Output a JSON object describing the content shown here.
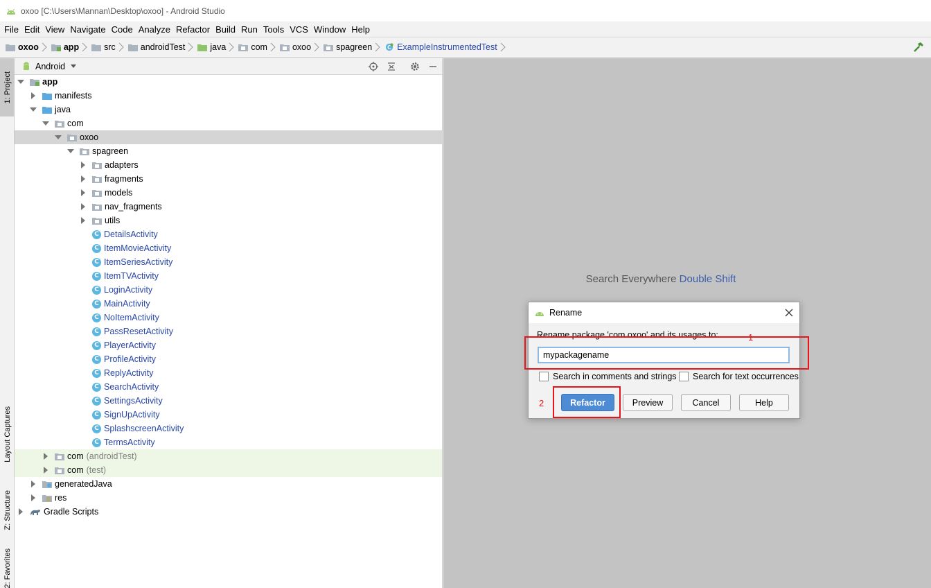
{
  "window": {
    "title": "oxoo [C:\\Users\\Mannan\\Desktop\\oxoo] - Android Studio"
  },
  "menu": [
    "File",
    "Edit",
    "View",
    "Navigate",
    "Code",
    "Analyze",
    "Refactor",
    "Build",
    "Run",
    "Tools",
    "VCS",
    "Window",
    "Help"
  ],
  "breadcrumb": [
    "oxoo",
    "app",
    "src",
    "androidTest",
    "java",
    "com",
    "oxoo",
    "spagreen",
    "ExampleInstrumentedTest"
  ],
  "tool_stripe": {
    "project": "1: Project",
    "layout_captures": "Layout Captures",
    "structure": "Z: Structure",
    "favorites": "2: Favorites"
  },
  "project_panel": {
    "view_mode": "Android",
    "tree": {
      "app": "app",
      "manifests": "manifests",
      "java": "java",
      "com": "com",
      "oxoo": "oxoo",
      "spagreen": "spagreen",
      "folders": [
        "adapters",
        "fragments",
        "models",
        "nav_fragments",
        "utils"
      ],
      "classes": [
        "DetailsActivity",
        "ItemMovieActivity",
        "ItemSeriesActivity",
        "ItemTVActivity",
        "LoginActivity",
        "MainActivity",
        "NoItemActivity",
        "PassResetActivity",
        "PlayerActivity",
        "ProfileActivity",
        "ReplyActivity",
        "SearchActivity",
        "SettingsActivity",
        "SignUpActivity",
        "SplashscreenActivity",
        "TermsActivity"
      ],
      "com_android_test": {
        "name": "com",
        "suffix": "(androidTest)"
      },
      "com_test": {
        "name": "com",
        "suffix": "(test)"
      },
      "generated_java": "generatedJava",
      "res": "res",
      "gradle_scripts": "Gradle Scripts"
    }
  },
  "editor": {
    "hint_text": "Search Everywhere",
    "hint_key": "Double Shift"
  },
  "dialog": {
    "title": "Rename",
    "prompt": "Rename package 'com.oxoo' and its usages to:",
    "input_value": "mypackagename",
    "checkbox_comments": "Search in comments and strings",
    "checkbox_text": "Search for text occurrences",
    "buttons": {
      "refactor": "Refactor",
      "preview": "Preview",
      "cancel": "Cancel",
      "help": "Help"
    }
  },
  "annotations": {
    "step1": "1",
    "step2": "2"
  },
  "colors": {
    "annotation_red": "#e8141a",
    "primary_button": "#4d8bd4",
    "class_link": "#2846a8",
    "editor_bg": "#c3c3c3"
  }
}
